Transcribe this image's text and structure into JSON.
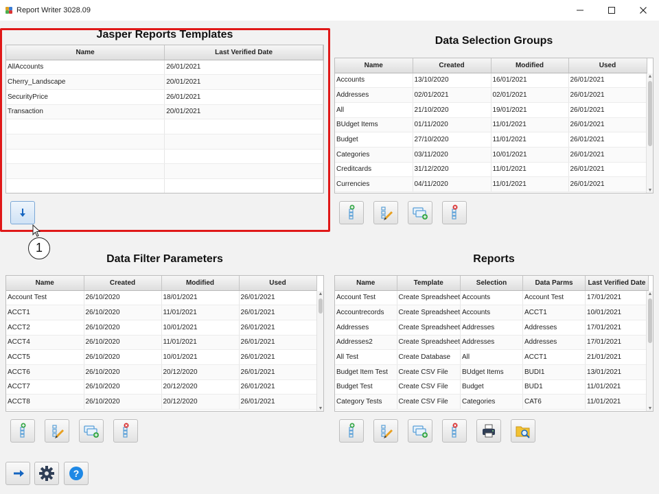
{
  "window": {
    "title": "Report Writer 3028.09"
  },
  "jasper": {
    "title": "Jasper Reports Templates",
    "columns": [
      "Name",
      "Last Verified Date"
    ],
    "rows": [
      [
        "AllAccounts",
        "26/01/2021"
      ],
      [
        "Cherry_Landscape",
        "20/01/2021"
      ],
      [
        "SecurityPrice",
        "26/01/2021"
      ],
      [
        "Transaction",
        "20/01/2021"
      ]
    ]
  },
  "dsg": {
    "title": "Data Selection Groups",
    "columns": [
      "Name",
      "Created",
      "Modified",
      "Used"
    ],
    "rows": [
      [
        "Accounts",
        "13/10/2020",
        "16/01/2021",
        "26/01/2021"
      ],
      [
        "Addresses",
        "02/01/2021",
        "02/01/2021",
        "26/01/2021"
      ],
      [
        "All",
        "21/10/2020",
        "19/01/2021",
        "26/01/2021"
      ],
      [
        "BUdget Items",
        "01/11/2020",
        "11/01/2021",
        "26/01/2021"
      ],
      [
        "Budget",
        "27/10/2020",
        "11/01/2021",
        "26/01/2021"
      ],
      [
        "Categories",
        "03/11/2020",
        "10/01/2021",
        "26/01/2021"
      ],
      [
        "Creditcards",
        "31/12/2020",
        "11/01/2021",
        "26/01/2021"
      ],
      [
        "Currencies",
        "04/11/2020",
        "11/01/2021",
        "26/01/2021"
      ]
    ]
  },
  "dfp": {
    "title": "Data Filter Parameters",
    "columns": [
      "Name",
      "Created",
      "Modified",
      "Used"
    ],
    "rows": [
      [
        "Account Test",
        "26/10/2020",
        "18/01/2021",
        "26/01/2021"
      ],
      [
        "ACCT1",
        "26/10/2020",
        "11/01/2021",
        "26/01/2021"
      ],
      [
        "ACCT2",
        "26/10/2020",
        "10/01/2021",
        "26/01/2021"
      ],
      [
        "ACCT4",
        "26/10/2020",
        "11/01/2021",
        "26/01/2021"
      ],
      [
        "ACCT5",
        "26/10/2020",
        "10/01/2021",
        "26/01/2021"
      ],
      [
        "ACCT6",
        "26/10/2020",
        "20/12/2020",
        "26/01/2021"
      ],
      [
        "ACCT7",
        "26/10/2020",
        "20/12/2020",
        "26/01/2021"
      ],
      [
        "ACCT8",
        "26/10/2020",
        "20/12/2020",
        "26/01/2021"
      ]
    ]
  },
  "reports": {
    "title": "Reports",
    "columns": [
      "Name",
      "Template",
      "Selection",
      "Data Parms",
      "Last Verified Date"
    ],
    "rows": [
      [
        "Account Test",
        "Create Spreadsheet",
        "Accounts",
        "Account Test",
        "17/01/2021"
      ],
      [
        "Accountrecords",
        "Create Spreadsheet",
        "Accounts",
        "ACCT1",
        "10/01/2021"
      ],
      [
        "Addresses",
        "Create Spreadsheet",
        "Addresses",
        "Addresses",
        "17/01/2021"
      ],
      [
        "Addresses2",
        "Create Spreadsheet",
        "Addresses",
        "Addresses",
        "17/01/2021"
      ],
      [
        "All Test",
        "Create Database",
        "All",
        "ACCT1",
        "21/01/2021"
      ],
      [
        "Budget Item Test",
        "Create CSV File",
        "BUdget Items",
        "BUDI1",
        "13/01/2021"
      ],
      [
        "Budget Test",
        "Create CSV File",
        "Budget",
        "BUD1",
        "11/01/2021"
      ],
      [
        "Category Tests",
        "Create CSV File",
        "Categories",
        "CAT6",
        "11/01/2021"
      ]
    ]
  },
  "annotation": {
    "callout": "1"
  },
  "icons": [
    "download-icon",
    "add-icon",
    "edit-icon",
    "copy-icon",
    "delete-icon",
    "print-icon",
    "search-folder-icon",
    "exit-icon",
    "settings-icon",
    "help-icon"
  ],
  "colors": {
    "highlight_frame": "#e01818",
    "button_blue": "#1565c0"
  }
}
